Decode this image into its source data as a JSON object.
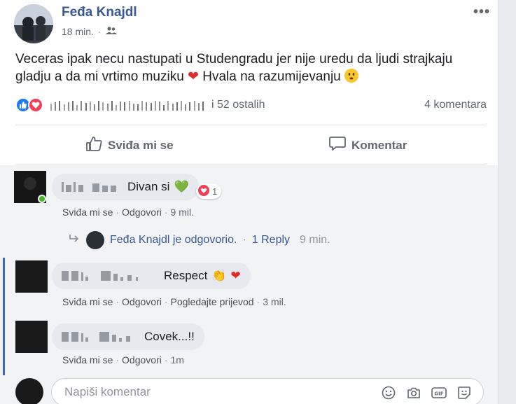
{
  "post": {
    "author": "Feđa Knajdl",
    "time": "18 min.",
    "more_label": "•••",
    "text": "Veceras ipak necu nastupati u Studengradu jer nije uredu da ljudi strajkaju gladju a da mi vrtimo muziku",
    "text_after_heart": "Hvala na razumijevanju",
    "others_label": "i 52 ostalih",
    "comments_count": "4 komentara"
  },
  "actions": {
    "like_label": "Sviđa mi se",
    "comment_label": "Komentar"
  },
  "comments": [
    {
      "text": "Divan si",
      "love_count": "1",
      "like_label": "Sviđa mi se",
      "reply_label": "Odgovori",
      "time": "9 mil."
    },
    {
      "text": "Respect",
      "like_label": "Sviđa mi se",
      "reply_label": "Odgovori",
      "translate_label": "Pogledajte prijevod",
      "time": "3 mil."
    },
    {
      "text": "Covek...!!",
      "like_label": "Sviđa mi se",
      "reply_label": "Odgovori",
      "time": "1m"
    }
  ],
  "reply_summary": {
    "text": "Feđa Knajdl je odgovorio.",
    "link": "1 Reply",
    "time": "9 min."
  },
  "composer": {
    "placeholder": "Napiši komentar"
  },
  "colors": {
    "author": "#385898",
    "like": "#2078f4",
    "love": "#f33e58",
    "thread_bar": "#4267b2"
  },
  "icons": [
    "friends-icon",
    "like-reaction-icon",
    "love-reaction-icon",
    "thumb-up-icon",
    "comment-icon",
    "reply-arrow-icon",
    "emoji-icon",
    "camera-icon",
    "gif-icon",
    "sticker-icon"
  ]
}
